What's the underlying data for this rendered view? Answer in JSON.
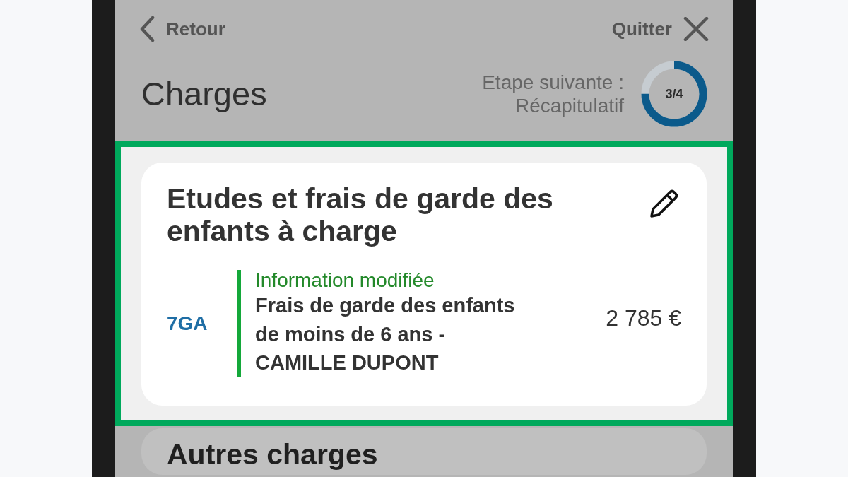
{
  "header": {
    "back_label": "Retour",
    "quit_label": "Quitter"
  },
  "page_title": "Charges",
  "next_step": {
    "label": "Etape suivante :",
    "name": "Récapitulatif"
  },
  "progress": {
    "text": "3/4",
    "level": 0.75
  },
  "sections": [
    {
      "title": "Etudes et frais de garde des enfants à charge",
      "highlighted": true,
      "entries": [
        {
          "code": "7GA",
          "modified": true,
          "status": "Information modifiée",
          "label": "Frais de garde des enfants de moins de 6 ans - CAMILLE DUPONT",
          "amount": "2 785 €"
        }
      ]
    },
    {
      "title": "Autres charges",
      "highlighted": false
    }
  ]
}
